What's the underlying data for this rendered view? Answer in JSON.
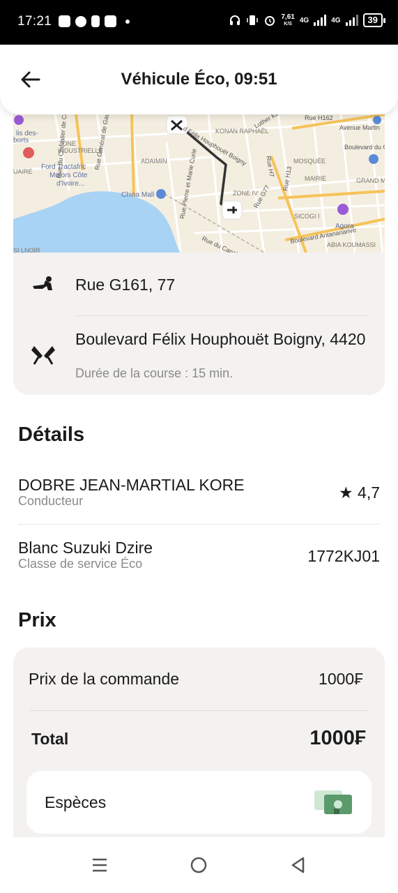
{
  "status_bar": {
    "time": "17:21",
    "speed_value": "7,61",
    "speed_unit": "K/S",
    "network_1": "4G",
    "network_2": "4G",
    "battery": "39"
  },
  "header": {
    "title": "Véhicule Éco, 09:51"
  },
  "map": {
    "labels": [
      "ZONE INDUSTRIELLE",
      "ADAIMIN",
      "Ford Tractafric Motors Côte d'Ivoire...",
      "China Mall",
      "KONAN RAPHAËL",
      "MOSQUÉE",
      "MAIRIE",
      "GRAND M",
      "ZONE IV",
      "SICOGI I",
      "Agora",
      "Boulevard Antananarivo",
      "ABIA KOUMASSI",
      "Rue H162",
      "Avenue Martin",
      "Boulevard du Gabon",
      "Rue H7",
      "Rue H13",
      "Rue G77",
      "Rue du Chevalier de Cli",
      "Rue Général de Gaulle",
      "Rue Pierre et Marie Curie",
      "Rue du Canal",
      "Luther King",
      "d Félix Houphouët Boigny",
      "lis des- borts",
      "UAIRE",
      "SI LNOIR"
    ]
  },
  "route": {
    "pickup": "Rue G161, 77",
    "destination": "Boulevard Félix Houphouët Boigny, 4420",
    "duration": "Durée de la course : 15 min."
  },
  "details": {
    "title": "Détails",
    "driver_name": "DOBRE JEAN-MARTIAL KORE",
    "driver_role": "Conducteur",
    "rating": "★ 4,7",
    "car": "Blanc Suzuki Dzire",
    "service_class": "Classe de service Éco",
    "plate": "1772KJ01"
  },
  "price": {
    "title": "Prix",
    "order_label": "Prix de la commande",
    "order_value": "1000₣",
    "total_label": "Total",
    "total_value": "1000₣",
    "payment_method": "Espèces"
  },
  "colors": {
    "card_bg": "#f3f2f0",
    "map_bg": "#f4eee0",
    "water": "#a9d3f5",
    "road_major": "#f6c35a",
    "route_line": "#333333",
    "cash_green": "#5b9a6b"
  }
}
